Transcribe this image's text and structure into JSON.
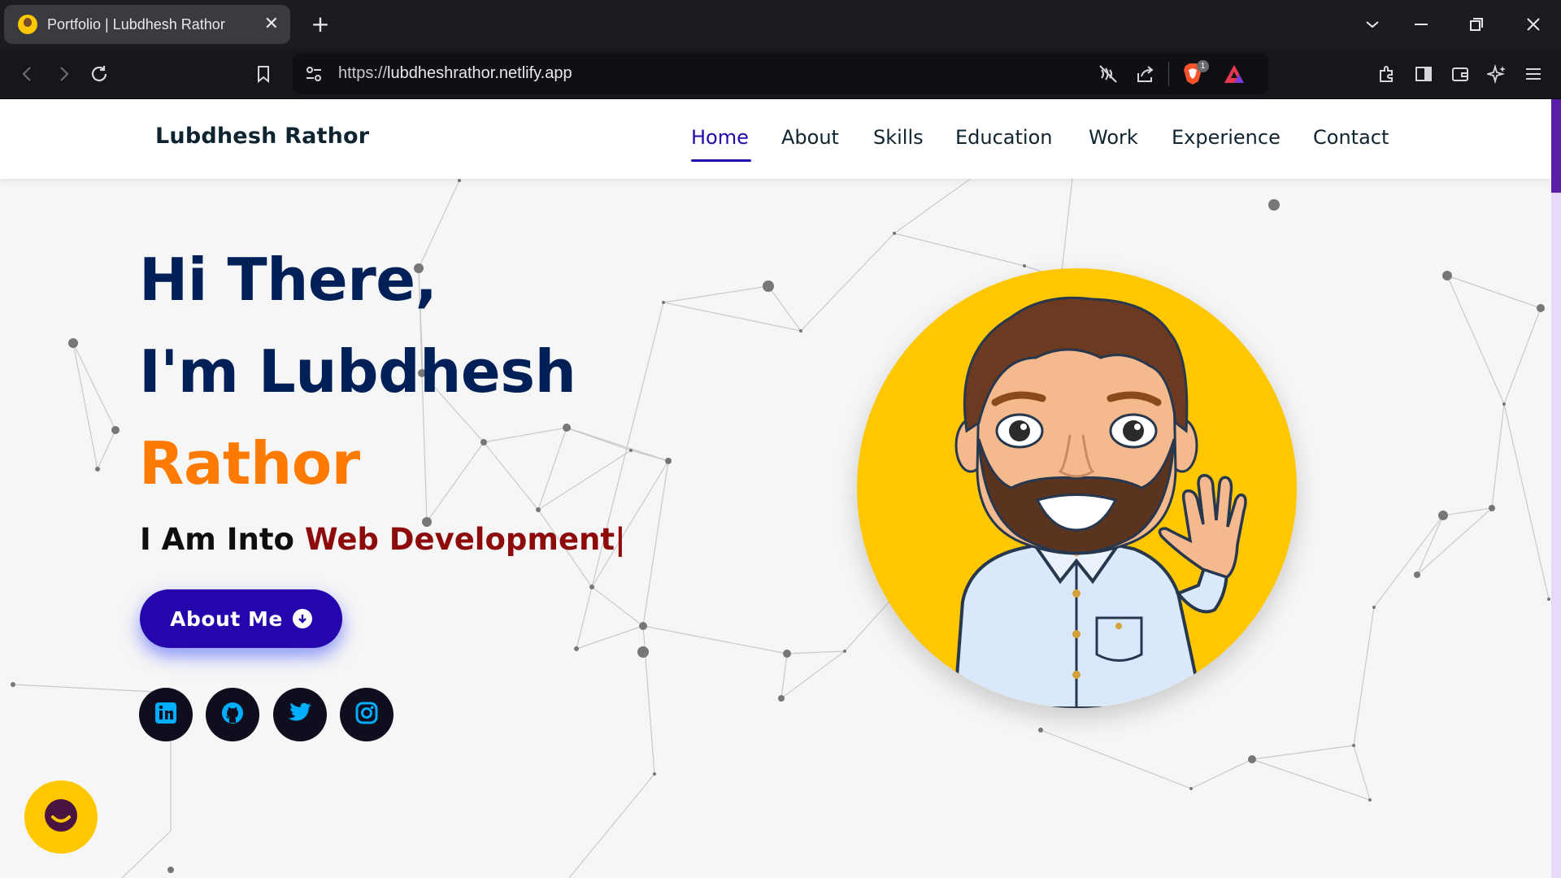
{
  "browser": {
    "tab_title": "Portfolio | Lubdhesh Rathor",
    "url_protocol": "https://",
    "url_host": "lubdheshrathor.netlify.app",
    "shield_badge": "1"
  },
  "site": {
    "brand": "Lubdhesh Rathor",
    "nav": [
      "Home",
      "About",
      "Skills",
      "Education",
      "Work",
      "Experience",
      "Contact"
    ],
    "active_nav": "Home",
    "hero": {
      "line1": "Hi There,",
      "line2": "I'm Lubdhesh",
      "line3": "Rathor",
      "typed_prefix": "I Am Into ",
      "typed_role": "Web Development|",
      "about_button": "About Me"
    },
    "social": [
      "linkedin-icon",
      "github-icon",
      "twitter-icon",
      "instagram-icon"
    ],
    "colors": {
      "primary": "#2506ad",
      "heading": "#002057",
      "accent_orange": "#ff7a00",
      "role_red": "#8d0b0b",
      "avatar_bg": "#ffc700",
      "social_icon": "#00aeff"
    }
  }
}
